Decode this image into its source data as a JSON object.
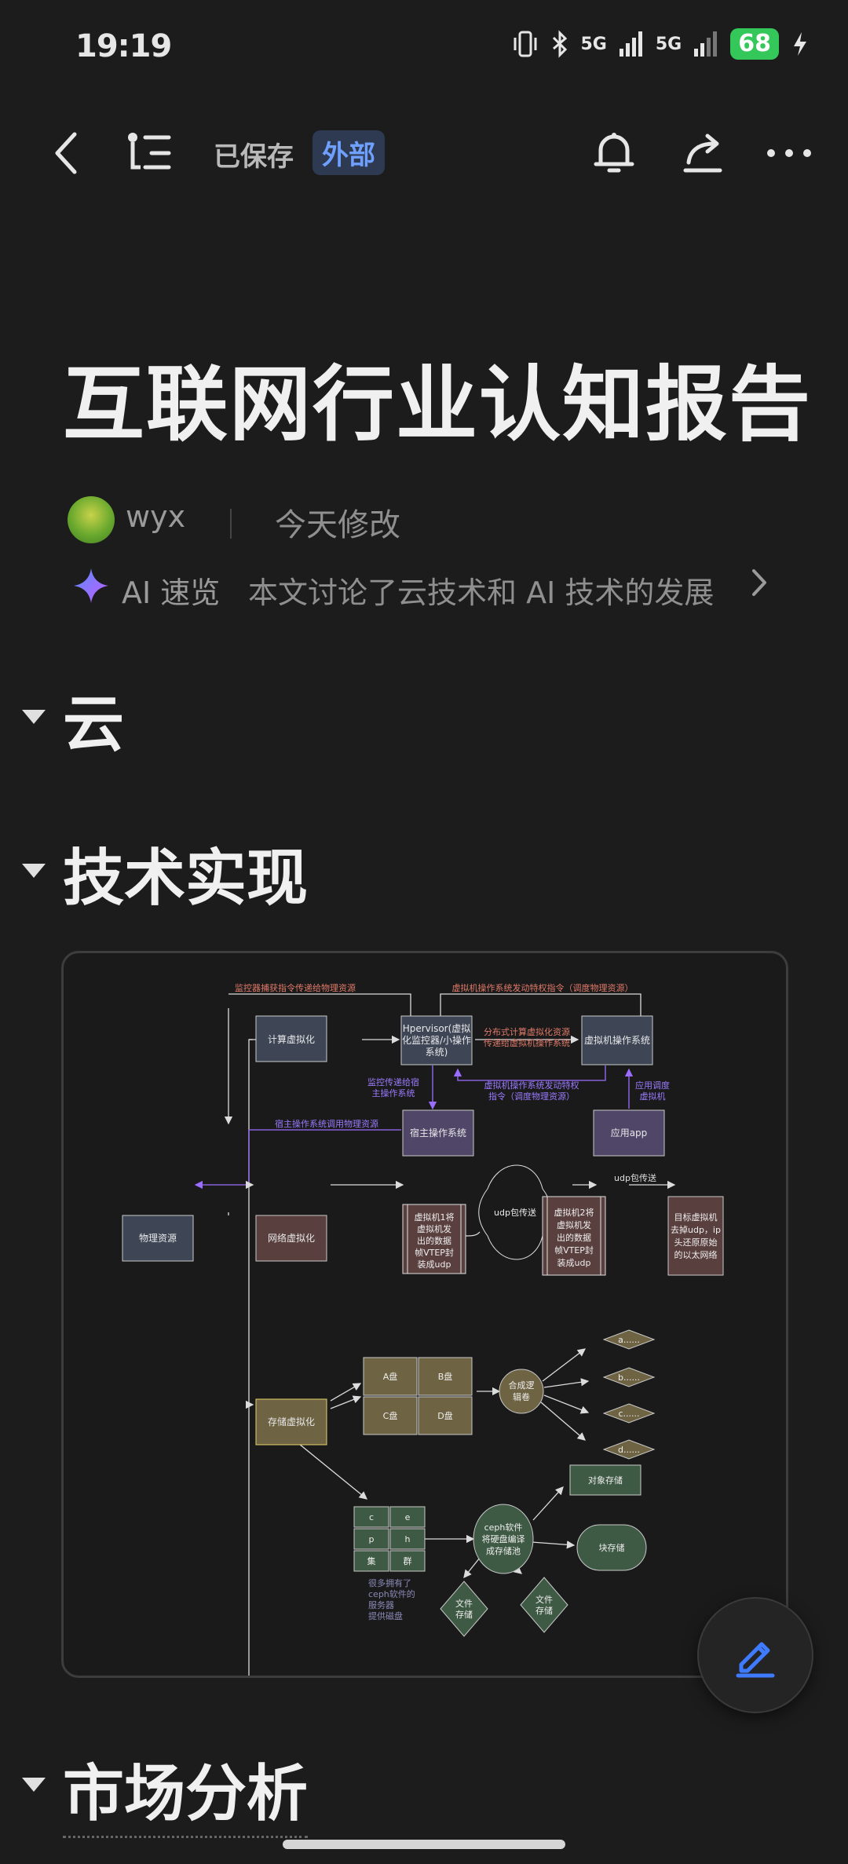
{
  "status_bar": {
    "time": "19:19",
    "signal1": "5G",
    "signal2": "5G",
    "battery": "68"
  },
  "toolbar": {
    "saved": "已保存",
    "badge": "外部"
  },
  "document": {
    "title": "互联网行业认知报告",
    "author": "wyx",
    "modified": "今天修改",
    "ai_label": "AI 速览",
    "ai_summary": "本文讨论了云技术和 AI 技术的发展"
  },
  "headings": [
    "云",
    "技术实现",
    "市场分析"
  ],
  "diagram": {
    "edge_labels": {
      "monitor_capture": "监控器捕获指令传递给物理资源",
      "vm_os_privileged": "虚拟机操作系统发动特权指令（调度物理资源）",
      "distributed": "分布式计算虚拟化资源",
      "pass_to_vm": "传递给虚拟机操作系统",
      "monitor_pass1": "监控传递给宿",
      "monitor_pass2": "主操作系统",
      "vm_os_priv1": "虚拟机操作系统发动特权",
      "vm_os_priv2": "指令（调度物理资源）",
      "app_sched1": "应用调度",
      "app_sched2": "虚拟机",
      "host_call": "宿主操作系统调用物理资源",
      "udp_transfer": "udp包传送",
      "cluster_note": [
        "很多拥有了",
        "ceph软件的",
        "服务器",
        "提供磁盘"
      ]
    },
    "nodes": {
      "compute": "计算虚拟化",
      "hypervisor": [
        "Hpervisor(虚拟",
        "化监控器/小操作",
        "系统)"
      ],
      "vm_os": "虚拟机操作系统",
      "host_os": "宿主操作系统",
      "app": "应用app",
      "physical": "物理资源",
      "network": "网络虚拟化",
      "vm1": [
        "虚拟机1将",
        "虚拟机发",
        "出的数据",
        "帧VTEP封",
        "装成udp"
      ],
      "udp_cloud": "udp包传送",
      "vm2": [
        "虚拟机2将",
        "虚拟机发",
        "出的数据",
        "帧VTEP封",
        "装成udp"
      ],
      "target": [
        "目标虚拟机",
        "去掉udp，ip",
        "头还原原始",
        "的以太网络"
      ],
      "storage": "存储虚拟化",
      "disk_a": "A盘",
      "disk_b": "B盘",
      "disk_c": "C盘",
      "disk_d": "D盘",
      "merge": [
        "合成逻",
        "辑卷"
      ],
      "out_a": "a......",
      "out_b": "b......",
      "out_c": "c......",
      "out_d": "d......",
      "cluster": [
        "c",
        "e",
        "p",
        "h",
        "集",
        "群"
      ],
      "ceph": [
        "ceph软件",
        "将硬盘编译",
        "成存储池"
      ],
      "object_storage": "对象存储",
      "block_storage": "块存储",
      "file1": [
        "文件",
        "存储"
      ],
      "file2": [
        "文件",
        "存储"
      ]
    }
  }
}
